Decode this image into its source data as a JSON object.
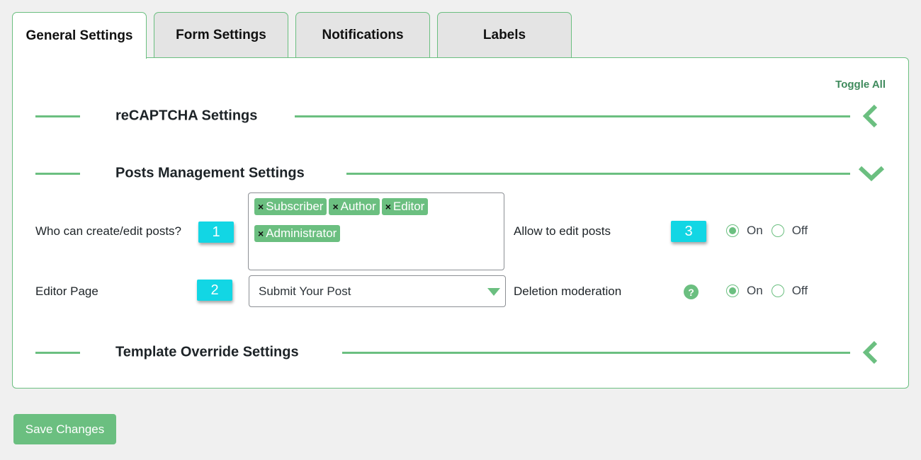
{
  "tabs": [
    {
      "label": "General Settings",
      "active": true
    },
    {
      "label": "Form Settings",
      "active": false
    },
    {
      "label": "Notifications",
      "active": false
    },
    {
      "label": "Labels",
      "active": false
    }
  ],
  "panel": {
    "toggle_all": "Toggle All",
    "sections": [
      {
        "title": "reCAPTCHA Settings",
        "state": "collapsed",
        "icon": "chevron-left-icon"
      },
      {
        "title": "Posts Management Settings",
        "state": "expanded",
        "icon": "chevron-down-icon"
      },
      {
        "title": "Template Override Settings",
        "state": "collapsed",
        "icon": "chevron-left-icon"
      }
    ],
    "posts_management": {
      "who_can_edit": {
        "label": "Who can create/edit posts?",
        "badge": "1",
        "selected_roles": [
          "Subscriber",
          "Author",
          "Editor",
          "Administrator"
        ],
        "remove_glyph": "×"
      },
      "editor_page": {
        "label": "Editor Page",
        "badge": "2",
        "selected": "Submit Your Post"
      },
      "allow_edit": {
        "label": "Allow to edit posts",
        "badge": "3",
        "options": [
          "On",
          "Off"
        ],
        "value": "On"
      },
      "deletion_moderation": {
        "label": "Deletion moderation",
        "help_glyph": "?",
        "options": [
          "On",
          "Off"
        ],
        "value": "On"
      }
    }
  },
  "save_button": "Save Changes",
  "colors": {
    "accent": "#6bbf80",
    "badge": "#12d6e4",
    "toggle_all": "#3f8b5d",
    "background": "#f0f0f0"
  }
}
